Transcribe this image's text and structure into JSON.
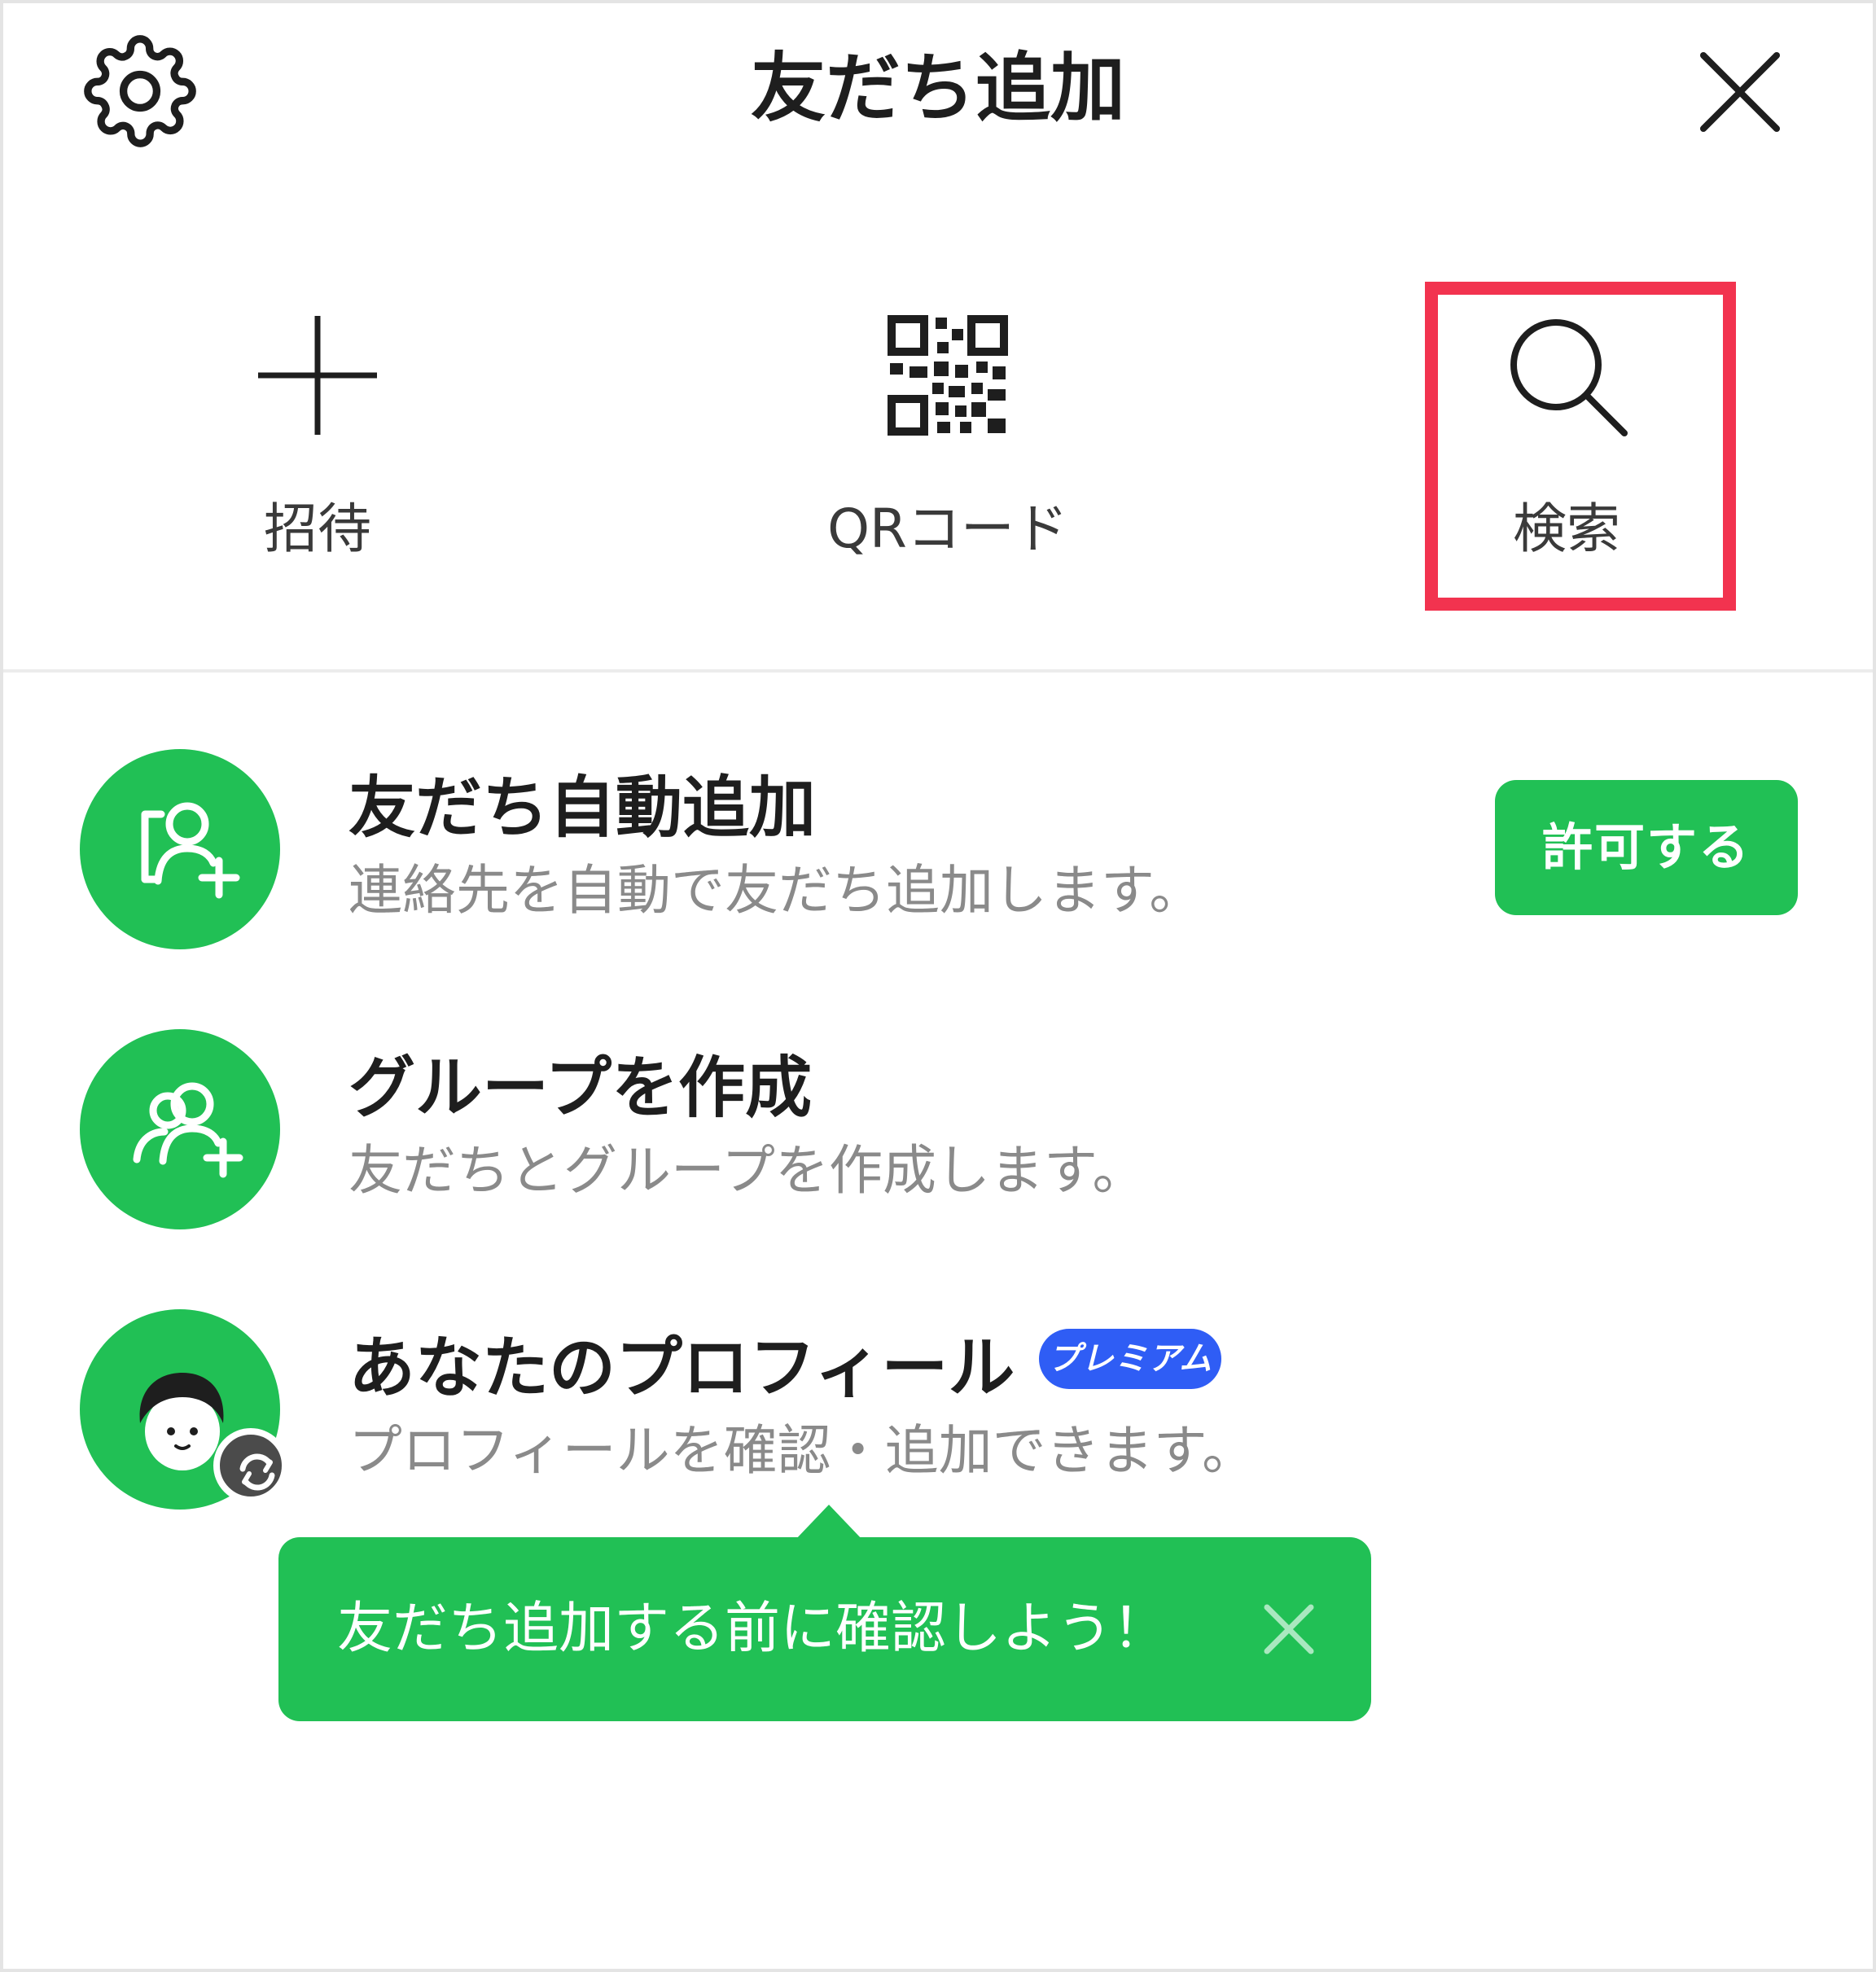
{
  "header": {
    "title": "友だち追加",
    "settings_icon": "gear-icon",
    "close_icon": "close-icon"
  },
  "actions": [
    {
      "label": "招待",
      "icon": "plus-icon"
    },
    {
      "label": "QRコード",
      "icon": "qr-code-icon"
    },
    {
      "label": "検索",
      "icon": "search-icon",
      "highlighted": true
    }
  ],
  "list": {
    "auto_add": {
      "title": "友だち自動追加",
      "description": "連絡先を自動で友だち追加します。",
      "button_label": "許可する",
      "icon": "contact-add-icon"
    },
    "create_group": {
      "title": "グループを作成",
      "description": "友だちとグループを作成します。",
      "icon": "group-add-icon"
    },
    "profile": {
      "title": "あなたのプロフィール",
      "badge": "プレミアム",
      "description": "プロフィールを確認・追加できます。",
      "icon": "person-avatar-icon",
      "sub_icon": "sync-icon"
    }
  },
  "tooltip": {
    "text": "友だち追加する前に確認しよう！",
    "close_icon": "close-icon"
  },
  "colors": {
    "brand_green": "#21c055",
    "highlight_red": "#f2334f",
    "premium_blue": "#2f5df5",
    "secondary_text": "#8a8a8a"
  }
}
